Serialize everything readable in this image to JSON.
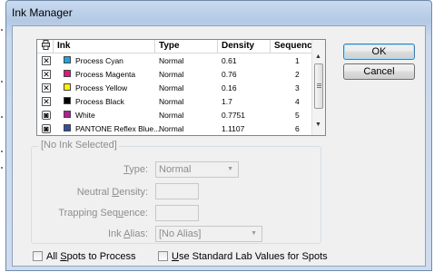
{
  "window": {
    "title": "Ink Manager"
  },
  "table": {
    "headers": {
      "visibility_icon": "printer-icon",
      "ink": "Ink",
      "type": "Type",
      "density": "Density",
      "sequence": "Sequence"
    },
    "rows": [
      {
        "icon": "process-ink-icon",
        "swatch": "#1aa6e0",
        "name": "Process Cyan",
        "type": "Normal",
        "density": "0.61",
        "sequence": "1"
      },
      {
        "icon": "process-ink-icon",
        "swatch": "#e0177f",
        "name": "Process Magenta",
        "type": "Normal",
        "density": "0.76",
        "sequence": "2"
      },
      {
        "icon": "process-ink-icon",
        "swatch": "#fff200",
        "name": "Process Yellow",
        "type": "Normal",
        "density": "0.16",
        "sequence": "3"
      },
      {
        "icon": "process-ink-icon",
        "swatch": "#000000",
        "name": "Process Black",
        "type": "Normal",
        "density": "1.7",
        "sequence": "4"
      },
      {
        "icon": "spot-ink-icon",
        "swatch": "#b0208e",
        "name": "White",
        "type": "Normal",
        "density": "0.7751",
        "sequence": "5"
      },
      {
        "icon": "spot-ink-icon",
        "swatch": "#2f4fa0",
        "name": "PANTONE Reflex Blue...",
        "type": "Normal",
        "density": "1.1107",
        "sequence": "6"
      }
    ]
  },
  "buttons": {
    "ok": "OK",
    "cancel": "Cancel"
  },
  "details": {
    "group_label": "[No Ink Selected]",
    "type": {
      "label_pre": "",
      "label_key": "T",
      "label_post": "ype:",
      "value": "Normal"
    },
    "neutral_density": {
      "label_pre": "Neutral ",
      "label_key": "D",
      "label_post": "ensity:",
      "value": ""
    },
    "trapping_sequence": {
      "label_pre": "Trapping Seq",
      "label_key": "u",
      "label_post": "ence:",
      "value": ""
    },
    "ink_alias": {
      "label_pre": "Ink ",
      "label_key": "A",
      "label_post": "lias:",
      "value": "[No Alias]"
    }
  },
  "options": {
    "all_spots": {
      "pre": "All ",
      "key": "S",
      "post": "pots to Process"
    },
    "standard_lab": {
      "pre": "",
      "key": "U",
      "post": "se Standard Lab Values for Spots"
    }
  }
}
